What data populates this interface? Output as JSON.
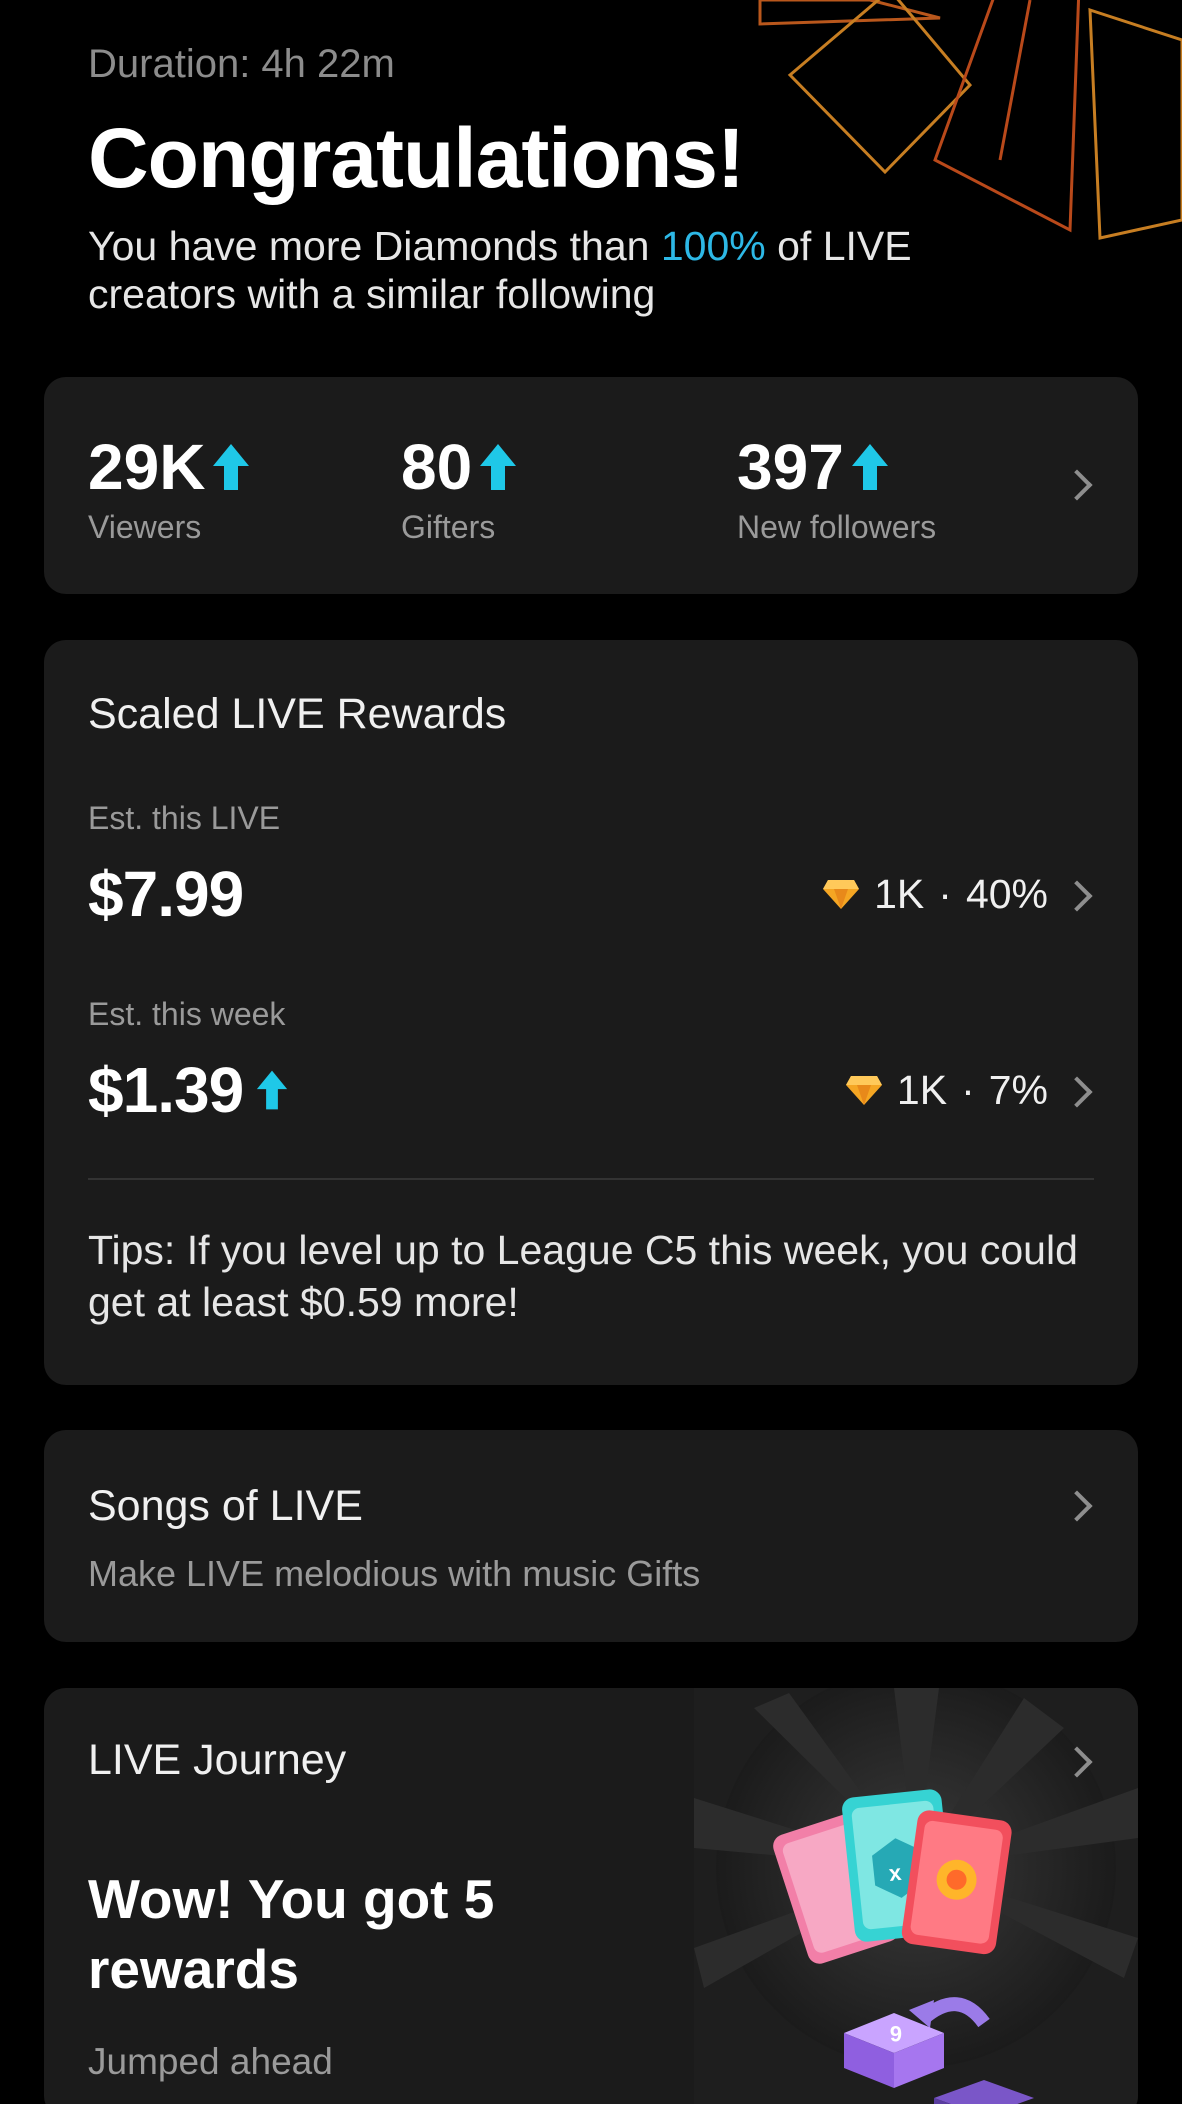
{
  "header": {
    "duration": "Duration: 4h 22m",
    "title": "Congratulations!",
    "subtitle_before": "You have more Diamonds than ",
    "subtitle_highlight": "100%",
    "subtitle_after": " of LIVE creators with a similar following"
  },
  "stats": [
    {
      "value": "29K",
      "label": "Viewers"
    },
    {
      "value": "80",
      "label": "Gifters"
    },
    {
      "value": "397",
      "label": "New followers"
    }
  ],
  "rewards": {
    "title": "Scaled LIVE Rewards",
    "this_live": {
      "label": "Est. this LIVE",
      "amount": "$7.99",
      "diamonds": "1K",
      "separator": "·",
      "percent": "40%"
    },
    "this_week": {
      "label": "Est. this week",
      "amount": "$1.39",
      "diamonds": "1K",
      "separator": "·",
      "percent": "7%"
    },
    "tips": "Tips: If you level up to League C5 this week, you could get at least $0.59 more!"
  },
  "songs": {
    "title": "Songs of LIVE",
    "subtitle": "Make LIVE melodious with music Gifts"
  },
  "journey": {
    "title": "LIVE Journey",
    "headline": "Wow! You got 5 rewards",
    "subtitle": "Jumped ahead"
  },
  "colors": {
    "accent_cyan": "#1fc8e8",
    "highlight_blue": "#2db8e6",
    "card_bg": "#1b1b1b",
    "gem_orange": "#f5a623"
  },
  "icons": [
    "up-arrow-icon",
    "chevron-right-icon",
    "diamond-icon"
  ]
}
